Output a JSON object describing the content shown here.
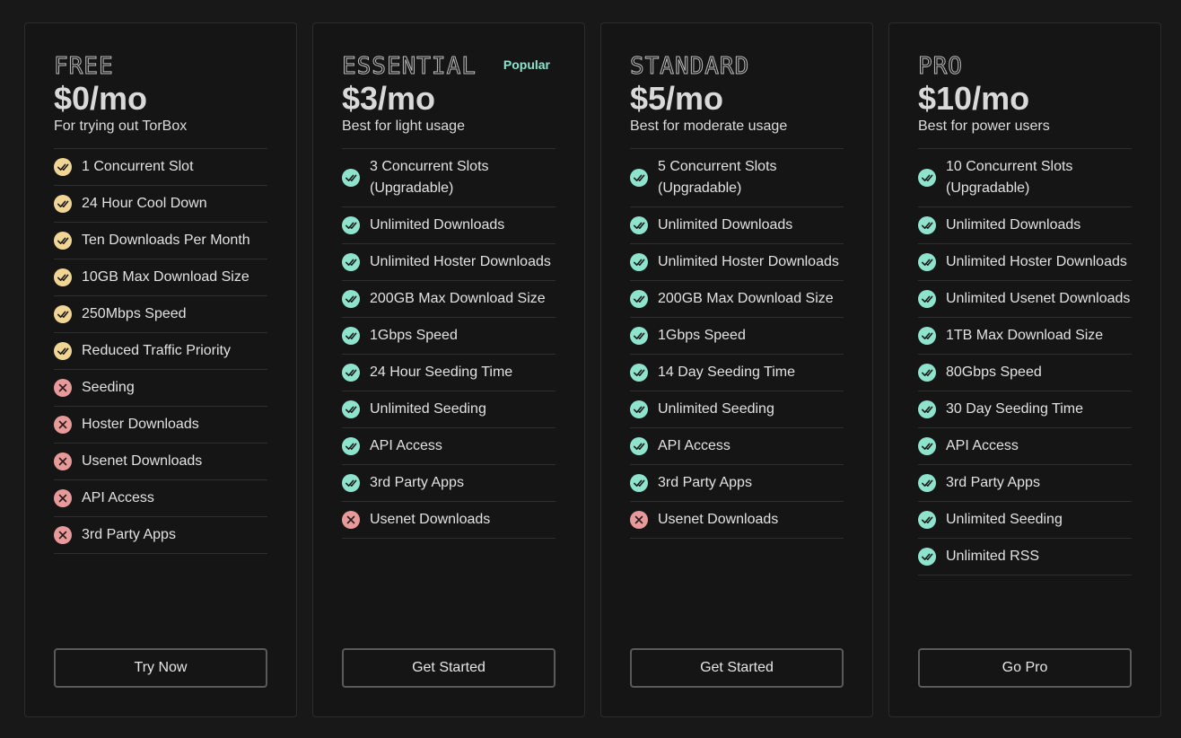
{
  "colors": {
    "check_limited": "#f1d595",
    "check_full": "#8ee3cc",
    "cross": "#e89a9a"
  },
  "plans": [
    {
      "name": "FREE",
      "badge": "",
      "price": "$0/mo",
      "tagline": "For trying out TorBox",
      "button": "Try Now",
      "features": [
        {
          "text": "1 Concurrent Slot",
          "status": "limited"
        },
        {
          "text": "24 Hour Cool Down",
          "status": "limited"
        },
        {
          "text": "Ten Downloads Per Month",
          "status": "limited"
        },
        {
          "text": "10GB Max Download Size",
          "status": "limited"
        },
        {
          "text": "250Mbps Speed",
          "status": "limited"
        },
        {
          "text": "Reduced Traffic Priority",
          "status": "limited"
        },
        {
          "text": "Seeding",
          "status": "excluded"
        },
        {
          "text": "Hoster Downloads",
          "status": "excluded"
        },
        {
          "text": "Usenet Downloads",
          "status": "excluded"
        },
        {
          "text": "API Access",
          "status": "excluded"
        },
        {
          "text": "3rd Party Apps",
          "status": "excluded"
        }
      ]
    },
    {
      "name": "ESSENTIAL",
      "badge": "Popular",
      "price": "$3/mo",
      "tagline": "Best for light usage",
      "button": "Get Started",
      "features": [
        {
          "text": "3 Concurrent Slots (Upgradable)",
          "status": "included"
        },
        {
          "text": "Unlimited Downloads",
          "status": "included"
        },
        {
          "text": "Unlimited Hoster Downloads",
          "status": "included"
        },
        {
          "text": "200GB Max Download Size",
          "status": "included"
        },
        {
          "text": "1Gbps Speed",
          "status": "included"
        },
        {
          "text": "24 Hour Seeding Time",
          "status": "included"
        },
        {
          "text": "Unlimited Seeding",
          "status": "included"
        },
        {
          "text": "API Access",
          "status": "included"
        },
        {
          "text": "3rd Party Apps",
          "status": "included"
        },
        {
          "text": "Usenet Downloads",
          "status": "excluded"
        }
      ]
    },
    {
      "name": "STANDARD",
      "badge": "",
      "price": "$5/mo",
      "tagline": "Best for moderate usage",
      "button": "Get Started",
      "features": [
        {
          "text": "5 Concurrent Slots (Upgradable)",
          "status": "included"
        },
        {
          "text": "Unlimited Downloads",
          "status": "included"
        },
        {
          "text": "Unlimited Hoster Downloads",
          "status": "included"
        },
        {
          "text": "200GB Max Download Size",
          "status": "included"
        },
        {
          "text": "1Gbps Speed",
          "status": "included"
        },
        {
          "text": "14 Day Seeding Time",
          "status": "included"
        },
        {
          "text": "Unlimited Seeding",
          "status": "included"
        },
        {
          "text": "API Access",
          "status": "included"
        },
        {
          "text": "3rd Party Apps",
          "status": "included"
        },
        {
          "text": "Usenet Downloads",
          "status": "excluded"
        }
      ]
    },
    {
      "name": "PRO",
      "badge": "",
      "price": "$10/mo",
      "tagline": "Best for power users",
      "button": "Go Pro",
      "features": [
        {
          "text": "10 Concurrent Slots (Upgradable)",
          "status": "included"
        },
        {
          "text": "Unlimited Downloads",
          "status": "included"
        },
        {
          "text": "Unlimited Hoster Downloads",
          "status": "included"
        },
        {
          "text": "Unlimited Usenet Downloads",
          "status": "included"
        },
        {
          "text": "1TB Max Download Size",
          "status": "included"
        },
        {
          "text": "80Gbps Speed",
          "status": "included"
        },
        {
          "text": "30 Day Seeding Time",
          "status": "included"
        },
        {
          "text": "API Access",
          "status": "included"
        },
        {
          "text": "3rd Party Apps",
          "status": "included"
        },
        {
          "text": "Unlimited Seeding",
          "status": "included"
        },
        {
          "text": "Unlimited RSS",
          "status": "included"
        }
      ]
    }
  ]
}
